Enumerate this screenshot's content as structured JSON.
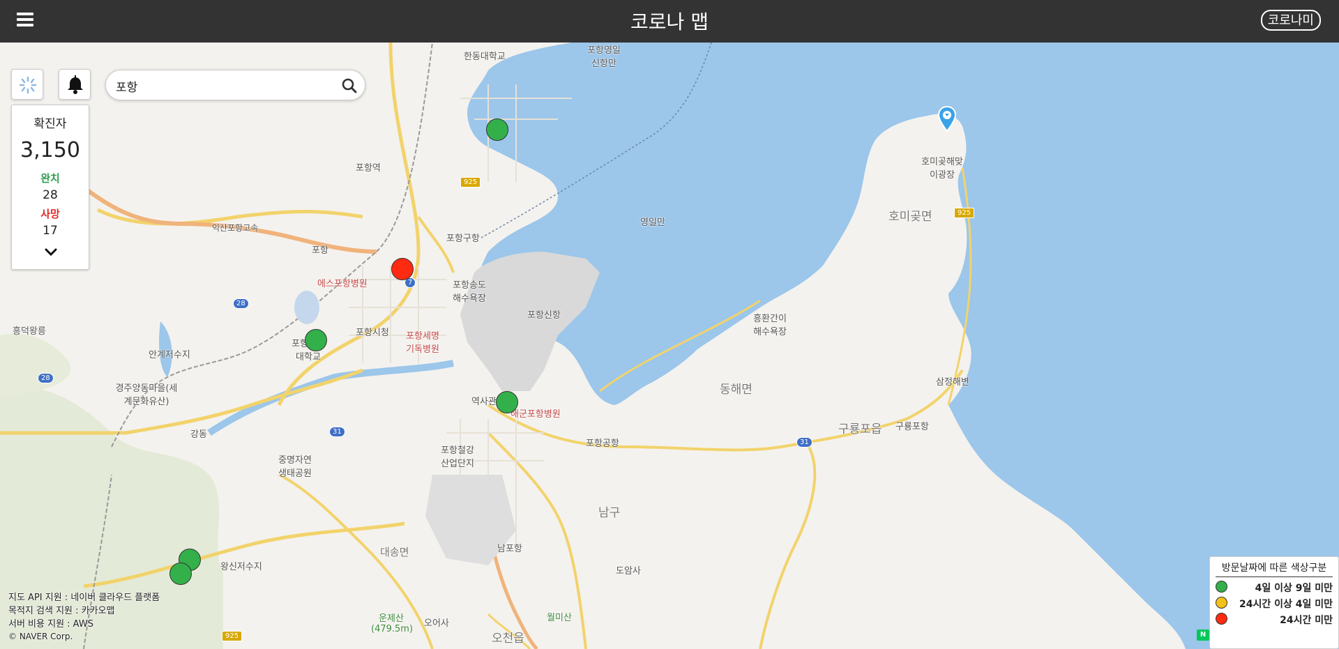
{
  "header": {
    "title": "코로나 맵",
    "corona_me_label": "코로나미"
  },
  "search": {
    "value": "포항",
    "placeholder": ""
  },
  "stats": {
    "confirmed_label": "확진자",
    "confirmed": "3,150",
    "recovered_label": "완치",
    "recovered": "28",
    "deaths_label": "사망",
    "deaths": "17"
  },
  "map_labels": [
    {
      "text": "한동대학교",
      "cls": ""
    },
    {
      "text": "포항영일신항만",
      "cls": ""
    },
    {
      "text": "포항역",
      "cls": ""
    },
    {
      "text": "영일만",
      "cls": ""
    },
    {
      "text": "호미곶해맞이광장",
      "cls": ""
    },
    {
      "text": "호미곶면",
      "cls": "big"
    },
    {
      "text": "포항구항",
      "cls": ""
    },
    {
      "text": "에스포항병원",
      "cls": "red"
    },
    {
      "text": "포항송도해수욕장",
      "cls": ""
    },
    {
      "text": "포항신항",
      "cls": ""
    },
    {
      "text": "흥환간이해수욕장",
      "cls": ""
    },
    {
      "text": "포항시청",
      "cls": ""
    },
    {
      "text": "포항세명기독병원",
      "cls": "red"
    },
    {
      "text": "흥덕왕릉",
      "cls": ""
    },
    {
      "text": "안계저수지",
      "cls": ""
    },
    {
      "text": "경주양동마을(세계문화유산)",
      "cls": ""
    },
    {
      "text": "익산포항고속",
      "cls": ""
    },
    {
      "text": "포항",
      "cls": ""
    },
    {
      "text": "포항공과대학교",
      "cls": ""
    },
    {
      "text": "역사관",
      "cls": ""
    },
    {
      "text": "해군포항병원",
      "cls": "red"
    },
    {
      "text": "포항공항",
      "cls": ""
    },
    {
      "text": "동해면",
      "cls": "big"
    },
    {
      "text": "구룡포읍",
      "cls": "big"
    },
    {
      "text": "구룡포항",
      "cls": ""
    },
    {
      "text": "삼정해변",
      "cls": ""
    },
    {
      "text": "강동",
      "cls": ""
    },
    {
      "text": "중명자연생태공원",
      "cls": ""
    },
    {
      "text": "포항철강산업단지",
      "cls": ""
    },
    {
      "text": "남구",
      "cls": "big"
    },
    {
      "text": "대송면",
      "cls": "big"
    },
    {
      "text": "남포항",
      "cls": ""
    },
    {
      "text": "도암사",
      "cls": ""
    },
    {
      "text": "왕신저수지",
      "cls": ""
    },
    {
      "text": "운제산(479.5m)",
      "cls": ""
    },
    {
      "text": "오어사",
      "cls": ""
    },
    {
      "text": "월미산",
      "cls": ""
    },
    {
      "text": "오천읍",
      "cls": "big"
    }
  ],
  "road_badges": [
    {
      "text": "925",
      "cls": "y"
    },
    {
      "text": "925",
      "cls": "y"
    },
    {
      "text": "925",
      "cls": "y"
    },
    {
      "text": "28",
      "cls": ""
    },
    {
      "text": "28",
      "cls": ""
    },
    {
      "text": "7",
      "cls": ""
    },
    {
      "text": "31",
      "cls": ""
    },
    {
      "text": "31",
      "cls": ""
    }
  ],
  "colors": {
    "green": "#33b04a",
    "yellow": "#f4c01a",
    "red": "#ff2b11",
    "sea": "#9cc6ea"
  },
  "legend": {
    "title": "방문날짜에 따른 색상구분",
    "items": [
      {
        "label": "4일 이상 9일 미만",
        "color": "#33b04a"
      },
      {
        "label": "24시간 이상 4일 미만",
        "color": "#f4c01a"
      },
      {
        "label": "24시간 미만",
        "color": "#ff2b11"
      }
    ]
  },
  "credits": {
    "line1": "지도 API 지원 : 네이버 클라우드 플랫폼",
    "line2": "목적지 검색 지원 : 카카오맵",
    "line3": "서버 비용 지원 : AWS",
    "line4": "© NAVER Corp."
  },
  "icons": {
    "menu": "hamburger-icon",
    "location": "loading-spinner-icon",
    "bell": "bell-icon",
    "search": "search-icon",
    "expand": "chevron-down-icon",
    "pin": "map-pin-icon"
  }
}
